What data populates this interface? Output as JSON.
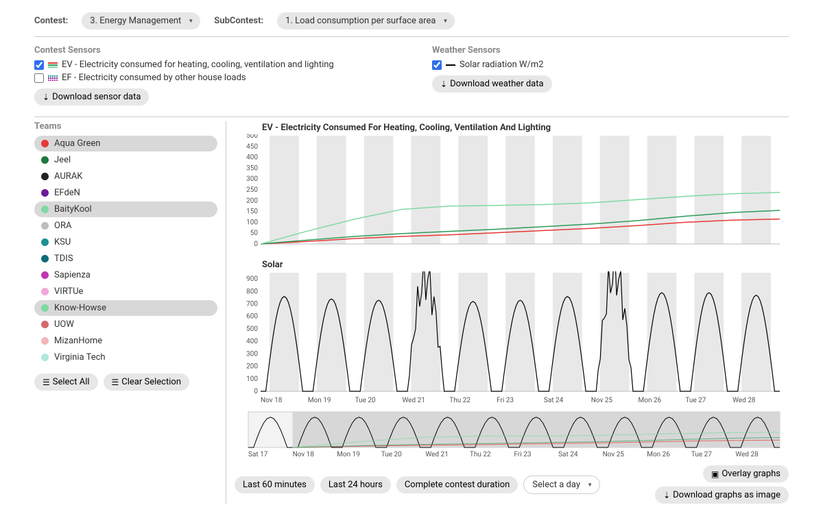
{
  "header": {
    "contest_label": "Contest:",
    "contest_value": "3. Energy Management",
    "subcontest_label": "SubContest:",
    "subcontest_value": "1. Load consumption per surface area"
  },
  "sensors": {
    "contest_title": "Contest Sensors",
    "weather_title": "Weather Sensors",
    "ev_label": "EV - Electricity consumed for heating, cooling, ventilation and lighting",
    "ef_label": "EF - Electricity consumed by other house loads",
    "solar_label": "Solar radiation W/m2",
    "download_sensor": "Download sensor data",
    "download_weather": "Download weather data"
  },
  "teams_title": "Teams",
  "teams": [
    {
      "name": "Aqua Green",
      "color": "#e53935",
      "selected": true
    },
    {
      "name": "Jeel",
      "color": "#1b7a3e",
      "selected": false
    },
    {
      "name": "AURAK",
      "color": "#222",
      "selected": false
    },
    {
      "name": "EFdeN",
      "color": "#6a1b9a",
      "selected": false
    },
    {
      "name": "BaityKool",
      "color": "#7ed9a2",
      "selected": true
    },
    {
      "name": "ORA",
      "color": "#bdbdbd",
      "selected": false
    },
    {
      "name": "KSU",
      "color": "#1c8f8f",
      "selected": false
    },
    {
      "name": "TDIS",
      "color": "#0d6b78",
      "selected": false
    },
    {
      "name": "Sapienza",
      "color": "#c036b0",
      "selected": false
    },
    {
      "name": "VIRTUe",
      "color": "#f2a6d9",
      "selected": false
    },
    {
      "name": "Know-Howse",
      "color": "#7ed9a2",
      "selected": true
    },
    {
      "name": "UOW",
      "color": "#d46a6a",
      "selected": false
    },
    {
      "name": "MizanHome",
      "color": "#f4b6b6",
      "selected": false
    },
    {
      "name": "Virginia Tech",
      "color": "#b0e8e0",
      "selected": false
    }
  ],
  "team_actions": {
    "select_all": "Select All",
    "clear": "Clear Selection"
  },
  "chart_titles": {
    "ev": "EV - Electricity Consumed For Heating, Cooling, Ventilation And Lighting",
    "solar": "Solar"
  },
  "x_labels": [
    "Nov 18",
    "Mon 19",
    "Tue 20",
    "Wed 21",
    "Thu 22",
    "Fri 23",
    "Sat 24",
    "Nov 25",
    "Mon 26",
    "Tue 27",
    "Wed 28"
  ],
  "overview_labels": [
    "Sat 17",
    "Nov 18",
    "Mon 19",
    "Tue 20",
    "Wed 21",
    "Thu 22",
    "Fri 23",
    "Sat 24",
    "Nov 25",
    "Mon 26",
    "Tue 27",
    "Wed 28"
  ],
  "footer": {
    "last60": "Last 60 minutes",
    "last24": "Last 24 hours",
    "full": "Complete contest duration",
    "select_day": "Select a day",
    "overlay": "Overlay graphs",
    "download_img": "Download graphs as image"
  },
  "chart_data": {
    "ev": {
      "type": "line",
      "title": "EV - Electricity Consumed For Heating, Cooling, Ventilation And Lighting",
      "ylabel": "",
      "xlabel": "",
      "ylim": [
        0,
        500
      ],
      "yticks": [
        0,
        50,
        100,
        150,
        200,
        250,
        300,
        350,
        400,
        450,
        500
      ],
      "categories": [
        "Nov 18",
        "Mon 19",
        "Tue 20",
        "Wed 21",
        "Thu 22",
        "Fri 23",
        "Sat 24",
        "Nov 25",
        "Mon 26",
        "Tue 27",
        "Wed 28"
      ],
      "series": [
        {
          "name": "Aqua Green",
          "color": "#e53935",
          "values": [
            0,
            12,
            25,
            35,
            42,
            52,
            62,
            72,
            85,
            100,
            110,
            115
          ]
        },
        {
          "name": "BaityKool",
          "color": "#2e9a57",
          "values": [
            0,
            18,
            35,
            48,
            58,
            68,
            80,
            92,
            108,
            128,
            145,
            155
          ]
        },
        {
          "name": "Know-Howse",
          "color": "#7ed9a2",
          "values": [
            0,
            60,
            115,
            160,
            175,
            178,
            182,
            190,
            205,
            220,
            232,
            238
          ]
        }
      ]
    },
    "solar": {
      "type": "line",
      "title": "Solar",
      "ylabel": "",
      "xlabel": "",
      "ylim": [
        0,
        950
      ],
      "yticks": [
        0,
        100,
        200,
        300,
        400,
        500,
        600,
        700,
        800,
        900
      ],
      "categories": [
        "Nov 18",
        "Mon 19",
        "Tue 20",
        "Wed 21",
        "Thu 22",
        "Fri 23",
        "Sat 24",
        "Nov 25",
        "Mon 26",
        "Tue 27",
        "Wed 28"
      ],
      "series": [
        {
          "name": "Solar radiation W/m2",
          "color": "#000",
          "daily_peaks": [
            760,
            740,
            730,
            900,
            720,
            730,
            760,
            950,
            790,
            790,
            770
          ]
        }
      ]
    }
  }
}
